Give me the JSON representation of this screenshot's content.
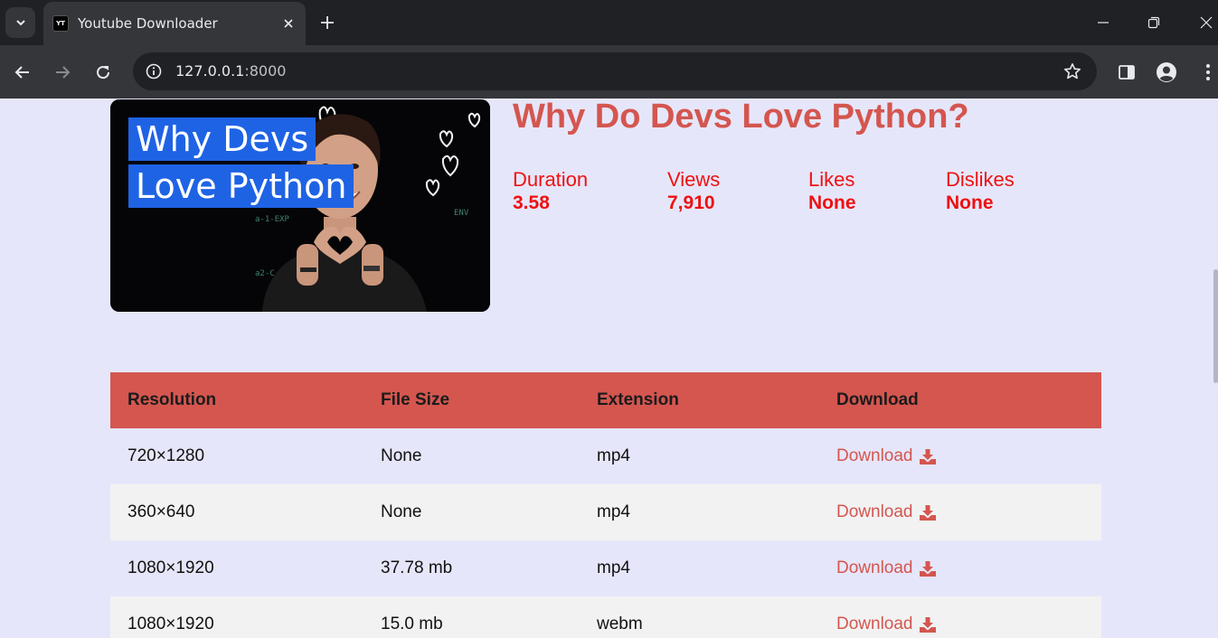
{
  "browser": {
    "tab_title": "Youtube Downloader",
    "tab_favicon_text": "YT",
    "url_host": "127.0.0.1",
    "url_port": ":8000"
  },
  "video": {
    "title": "Why Do Devs Love Python?",
    "thumbnail_lines": [
      "Why Devs",
      "Love Python"
    ],
    "stats": [
      {
        "label": "Duration",
        "value": "3.58"
      },
      {
        "label": "Views",
        "value": "7,910"
      },
      {
        "label": "Likes",
        "value": "None"
      },
      {
        "label": "Dislikes",
        "value": "None"
      }
    ]
  },
  "table": {
    "headers": [
      "Resolution",
      "File Size",
      "Extension",
      "Download"
    ],
    "rows": [
      {
        "resolution": "720×1280",
        "size": "None",
        "ext": "mp4",
        "download": "Download"
      },
      {
        "resolution": "360×640",
        "size": "None",
        "ext": "mp4",
        "download": "Download"
      },
      {
        "resolution": "1080×1920",
        "size": "37.78 mb",
        "ext": "mp4",
        "download": "Download"
      },
      {
        "resolution": "1080×1920",
        "size": "15.0 mb",
        "ext": "webm",
        "download": "Download"
      }
    ]
  },
  "colors": {
    "page_bg": "#e6e6fa",
    "accent": "#d4564f",
    "stat_red": "#ee1111",
    "row_alt": "#f2f2f2"
  },
  "icons": [
    "chevron-down-icon",
    "close-icon",
    "plus-icon",
    "minimize-icon",
    "restore-icon",
    "back-icon",
    "forward-icon",
    "reload-icon",
    "info-icon",
    "star-icon",
    "side-panel-icon",
    "profile-icon",
    "kebab-menu-icon",
    "download-icon"
  ]
}
